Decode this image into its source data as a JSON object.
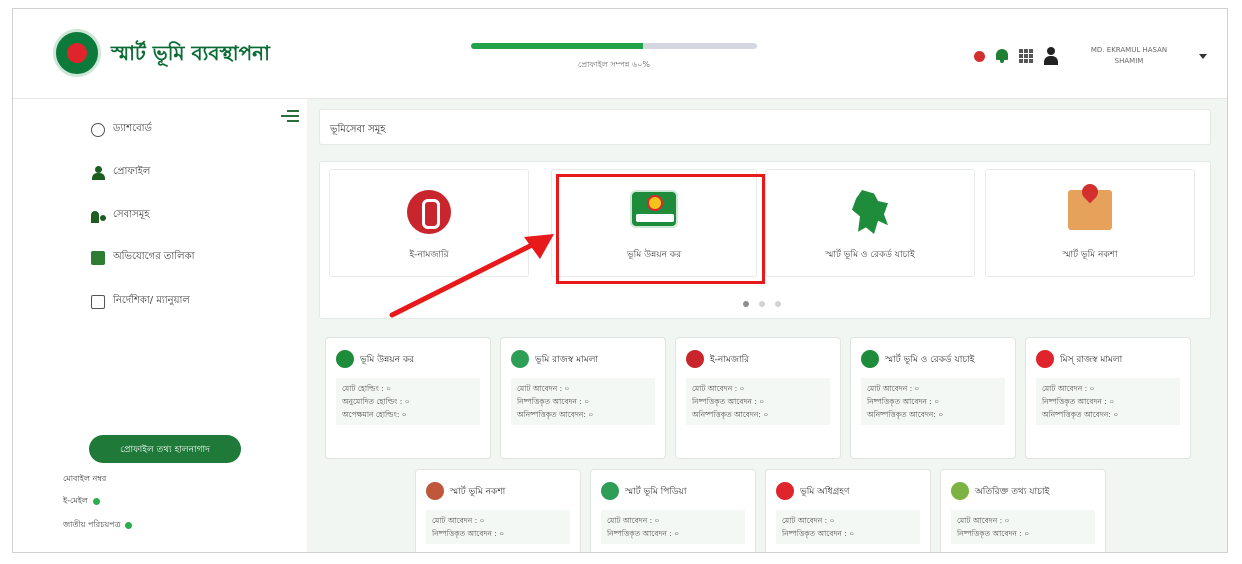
{
  "header": {
    "brand": "স্মার্ট ভূমি ব্যবস্থাপনা",
    "progress_label": "প্রোফাইল সম্পন্ন ৬০%",
    "progress_fraction": 0.6,
    "user_name_line1": "MD. EKRAMUL HASAN",
    "user_name_line2": "SHAMIM"
  },
  "sidebar": {
    "items": [
      {
        "label": "ড্যাশবোর্ড",
        "icon": "dashboard-icon"
      },
      {
        "label": "প্রোফাইল",
        "icon": "profile-icon"
      },
      {
        "label": "সেবাসমূহ",
        "icon": "services-icon"
      },
      {
        "label": "অভিযোগের তালিকা",
        "icon": "complaint-icon"
      },
      {
        "label": "নির্দেশিকা/ ম্যানুয়াল",
        "icon": "guide-icon"
      }
    ],
    "profile_button": "প্রোফাইল তথ্য হালনাগাদ",
    "mobile_label": "মোবাইল নম্বর",
    "email_label": "ই-মেইল",
    "nid_label": "জাতীয় পরিচয়পত্র"
  },
  "main": {
    "section_title": "ভূমিসেবা সমূহ",
    "carousel": [
      {
        "label": "ই-নামজারি",
        "icon": "e-mutation-icon"
      },
      {
        "label": "ভূমি উন্নয়ন কর",
        "icon": "land-tax-icon"
      },
      {
        "label": "স্মার্ট ভূমি ও রেকর্ড যাচাই",
        "icon": "bangladesh-map-icon"
      },
      {
        "label": "স্মার্ট ভূমি নকশা",
        "icon": "map-pin-icon"
      }
    ],
    "stat_cards_row1": [
      {
        "title": "ভূমি উন্নয়ন কর",
        "lines": [
          "মোট হোল্ডিং : ০",
          "অনুমোদিত হোল্ডিং : ০",
          "অপেক্ষমান হোল্ডিং: ০"
        ],
        "color": "#1f8c3b"
      },
      {
        "title": "ভূমি রাজস্ব মামলা",
        "lines": [
          "মোট আবেদন : ০",
          "নিষ্পত্তিকৃত আবেদন : ০",
          "অনিষ্পত্তিকৃত আবেদন: ০"
        ],
        "color": "#2e9d55"
      },
      {
        "title": "ই-নামজারি",
        "lines": [
          "মোট আবেদন : ০",
          "নিষ্পত্তিকৃত আবেদন : ০",
          "অনিষ্পত্তিকৃত আবেদন: ০"
        ],
        "color": "#c8262c"
      },
      {
        "title": "স্মার্ট ভূমি ও রেকর্ড যাচাই",
        "lines": [
          "মোট আবেদন : ০",
          "নিষ্পত্তিকৃত আবেদন : ০",
          "অনিষ্পত্তিকৃত আবেদন: ০"
        ],
        "color": "#1f8c3b"
      },
      {
        "title": "মিস্ রাজস্ব মামলা",
        "lines": [
          "মোট আবেদন : ০",
          "নিষ্পত্তিকৃত আবেদন : ০",
          "অনিষ্পত্তিকৃত আবেদন: ০"
        ],
        "color": "#e0242b"
      }
    ],
    "stat_cards_row2": [
      {
        "title": "স্মার্ট ভূমি নকশা",
        "lines": [
          "মোট আবেদন : ০",
          "নিষ্পত্তিকৃত আবেদন : ০"
        ],
        "color": "#c0563a"
      },
      {
        "title": "স্মার্ট ভূমি পিডিয়া",
        "lines": [
          "মোট আবেদন : ০",
          "নিষ্পত্তিকৃত আবেদন : ০"
        ],
        "color": "#2e9d55"
      },
      {
        "title": "ভূমি অধিগ্রহণ",
        "lines": [
          "মোট আবেদন : ০",
          "নিষ্পত্তিকৃত আবেদন : ০"
        ],
        "color": "#e0242b"
      },
      {
        "title": "অতিরিক্ত তথ্য যাচাই",
        "lines": [
          "মোট আবেদন : ০",
          "নিষ্পত্তিকৃত আবেদন : ০"
        ],
        "color": "#7cb342"
      }
    ]
  },
  "colors": {
    "accent": "#1f7a3a",
    "highlight": "#e8191b"
  }
}
